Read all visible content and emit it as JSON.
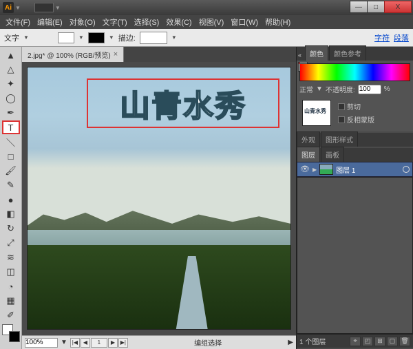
{
  "app": {
    "logo": "Ai"
  },
  "titlebar": {
    "min": "—",
    "max": "□",
    "close": "X"
  },
  "menu": {
    "items": [
      "文件(F)",
      "编辑(E)",
      "对象(O)",
      "文字(T)",
      "选择(S)",
      "效果(C)",
      "视图(V)",
      "窗口(W)",
      "帮助(H)"
    ]
  },
  "options": {
    "label_left": "文字",
    "stroke_label": "描边:",
    "char_link": "字符",
    "para_link": "段落"
  },
  "document": {
    "tab_title": "2.jpg* @ 100% (RGB/预览)",
    "artwork_text": "山青水秀",
    "zoom": "100%",
    "page": "1",
    "status": "编组选择"
  },
  "panels": {
    "color": {
      "tab1": "颜色",
      "tab2": "颜色参考",
      "mode_label": "正常",
      "opacity_label": "不透明度:",
      "opacity_value": "100",
      "opacity_pct": "%"
    },
    "clip": {
      "chk_clip": "剪切",
      "chk_invert": "反相蒙版"
    },
    "appearance": {
      "tab1": "外观",
      "tab2": "图形样式"
    },
    "layers": {
      "tab1": "图层",
      "tab2": "画板",
      "layer_name": "图层 1",
      "footer_count": "1 个图层"
    }
  }
}
